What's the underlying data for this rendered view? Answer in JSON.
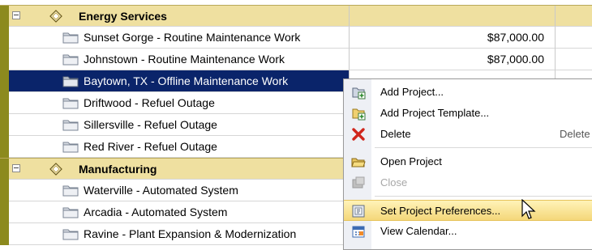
{
  "groups": [
    {
      "name": "Energy Services"
    },
    {
      "name": "Manufacturing"
    }
  ],
  "projects": [
    {
      "name": "Sunset Gorge - Routine Maintenance Work",
      "amount": "$87,000.00"
    },
    {
      "name": "Johnstown - Routine Maintenance Work",
      "amount": "$87,000.00"
    },
    {
      "name": "Baytown, TX - Offline Maintenance Work",
      "amount": ""
    },
    {
      "name": "Driftwood - Refuel Outage",
      "amount": ""
    },
    {
      "name": "Sillersville - Refuel Outage",
      "amount": ""
    },
    {
      "name": "Red River - Refuel Outage",
      "amount": ""
    },
    {
      "name": "Waterville - Automated System",
      "amount": ""
    },
    {
      "name": "Arcadia - Automated System",
      "amount": ""
    },
    {
      "name": "Ravine - Plant Expansion & Modernization",
      "amount": ""
    }
  ],
  "context_menu": {
    "items": [
      {
        "label": "Add Project...",
        "icon": "add-project-icon"
      },
      {
        "label": "Add Project Template...",
        "icon": "add-template-icon"
      },
      {
        "label": "Delete",
        "shortcut": "Delete",
        "icon": "delete-icon"
      },
      {
        "label": "Open Project",
        "icon": "open-project-icon"
      },
      {
        "label": "Close",
        "icon": "close-project-icon",
        "disabled": true
      },
      {
        "label": "Set Project Preferences...",
        "icon": "preferences-icon",
        "highlighted": true
      },
      {
        "label": "View Calendar...",
        "icon": "calendar-icon"
      }
    ]
  },
  "colors": {
    "group_row_bg": "#efe0a0",
    "selection_bg": "#0a246a",
    "stripe": "#8c8a1e",
    "menu_highlight": "#f4d77a"
  }
}
